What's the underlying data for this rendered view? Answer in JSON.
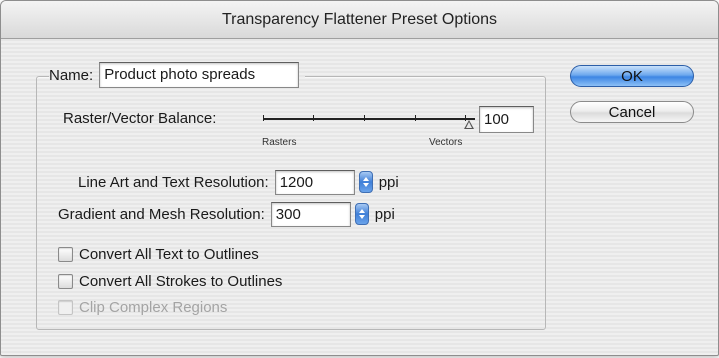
{
  "window": {
    "title": "Transparency Flattener Preset Options"
  },
  "name_field": {
    "label": "Name:",
    "value": "Product photo spreads"
  },
  "balance": {
    "label": "Raster/Vector Balance:",
    "value": "100",
    "slider_fraction": 1.0,
    "min_label": "Rasters",
    "max_label": "Vectors"
  },
  "line_art": {
    "label": "Line Art and Text Resolution:",
    "value": "1200",
    "unit": "ppi"
  },
  "gradient": {
    "label": "Gradient and Mesh Resolution:",
    "value": "300",
    "unit": "ppi"
  },
  "checkboxes": [
    {
      "label": "Convert All Text to Outlines",
      "checked": false,
      "enabled": true
    },
    {
      "label": "Convert All Strokes to Outlines",
      "checked": false,
      "enabled": true
    },
    {
      "label": "Clip Complex Regions",
      "checked": false,
      "enabled": false
    }
  ],
  "buttons": {
    "ok": "OK",
    "cancel": "Cancel"
  },
  "colors": {
    "default_button": "#3d86e4",
    "disabled_text": "#a4a4a4"
  }
}
